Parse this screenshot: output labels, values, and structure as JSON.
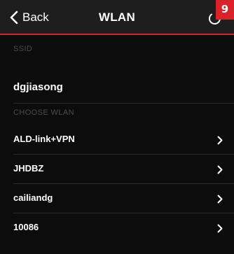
{
  "navbar": {
    "back_label": "Back",
    "title": "WLAN",
    "back_icon": "chevron-left-icon",
    "refresh_icon": "refresh-icon",
    "accent_color": "#d8232a"
  },
  "badge": {
    "text": "9"
  },
  "ssid_section": {
    "header": "SSID",
    "value": "dgjiasong"
  },
  "wlan_section": {
    "header": "CHOOSE WLAN",
    "networks": [
      {
        "name": "ALD-link+VPN"
      },
      {
        "name": "JHDBZ"
      },
      {
        "name": "cailiandg"
      },
      {
        "name": "10086"
      }
    ]
  }
}
